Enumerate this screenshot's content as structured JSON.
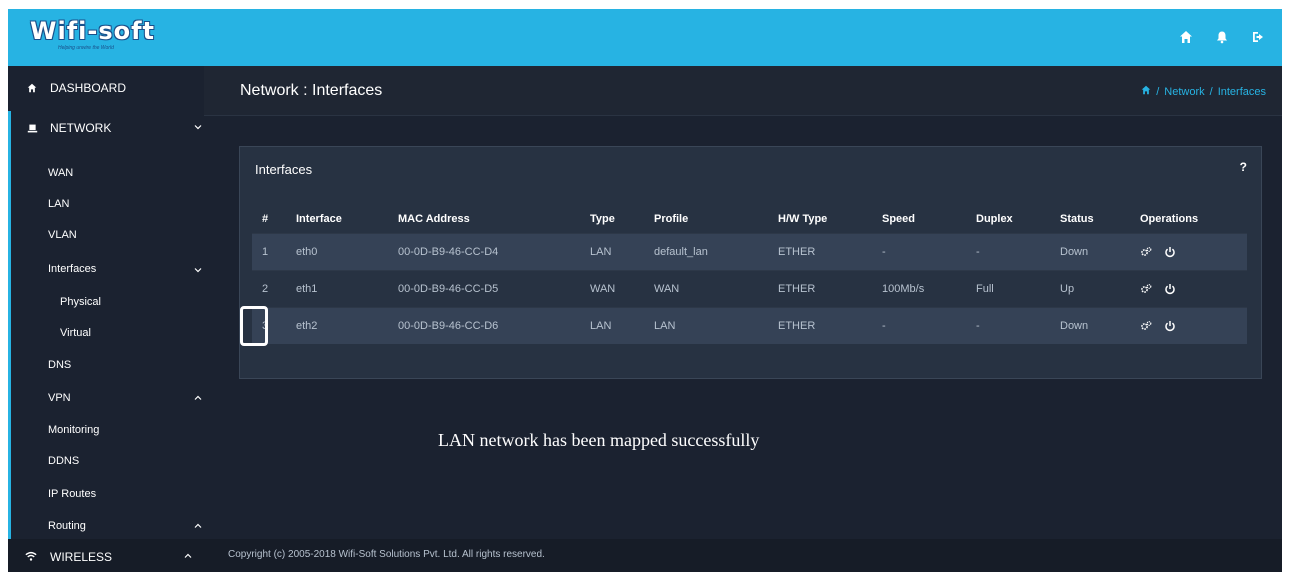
{
  "header": {
    "logo_text": "Wifi-soft",
    "logo_tagline": "Helping unwire the World",
    "icons": [
      "home-icon",
      "bell-icon",
      "logout-icon"
    ]
  },
  "sidebar": {
    "dashboard": "DASHBOARD",
    "network": "NETWORK",
    "wan": "WAN",
    "lan": "LAN",
    "vlan": "VLAN",
    "interfaces": "Interfaces",
    "physical": "Physical",
    "virtual": "Virtual",
    "dns": "DNS",
    "vpn": "VPN",
    "monitoring": "Monitoring",
    "ddns": "DDNS",
    "ip_routes": "IP Routes",
    "routing": "Routing",
    "wireless": "WIRELESS"
  },
  "page": {
    "title": "Network : Interfaces",
    "breadcrumb": [
      "Network",
      "Interfaces"
    ]
  },
  "panel": {
    "title": "Interfaces",
    "help": "?",
    "columns": [
      "#",
      "Interface",
      "MAC Address",
      "Type",
      "Profile",
      "H/W Type",
      "Speed",
      "Duplex",
      "Status",
      "Operations"
    ],
    "rows": [
      {
        "num": "1",
        "iface": "eth0",
        "mac": "00-0D-B9-46-CC-D4",
        "type": "LAN",
        "profile": "default_lan",
        "hw": "ETHER",
        "speed": "-",
        "duplex": "-",
        "status": "Down"
      },
      {
        "num": "2",
        "iface": "eth1",
        "mac": "00-0D-B9-46-CC-D5",
        "type": "WAN",
        "profile": "WAN",
        "hw": "ETHER",
        "speed": "100Mb/s",
        "duplex": "Full",
        "status": "Up"
      },
      {
        "num": "3",
        "iface": "eth2",
        "mac": "00-0D-B9-46-CC-D6",
        "type": "LAN",
        "profile": "LAN",
        "hw": "ETHER",
        "speed": "-",
        "duplex": "-",
        "status": "Down"
      }
    ]
  },
  "message": "LAN network has been mapped successfully",
  "footer": {
    "copyright": "Copyright (c) 2005-2018 Wifi-Soft Solutions Pvt. Ltd. All rights reserved."
  },
  "colors": {
    "accent": "#27b3e3",
    "background": "#1b2230",
    "panel": "#273242"
  }
}
